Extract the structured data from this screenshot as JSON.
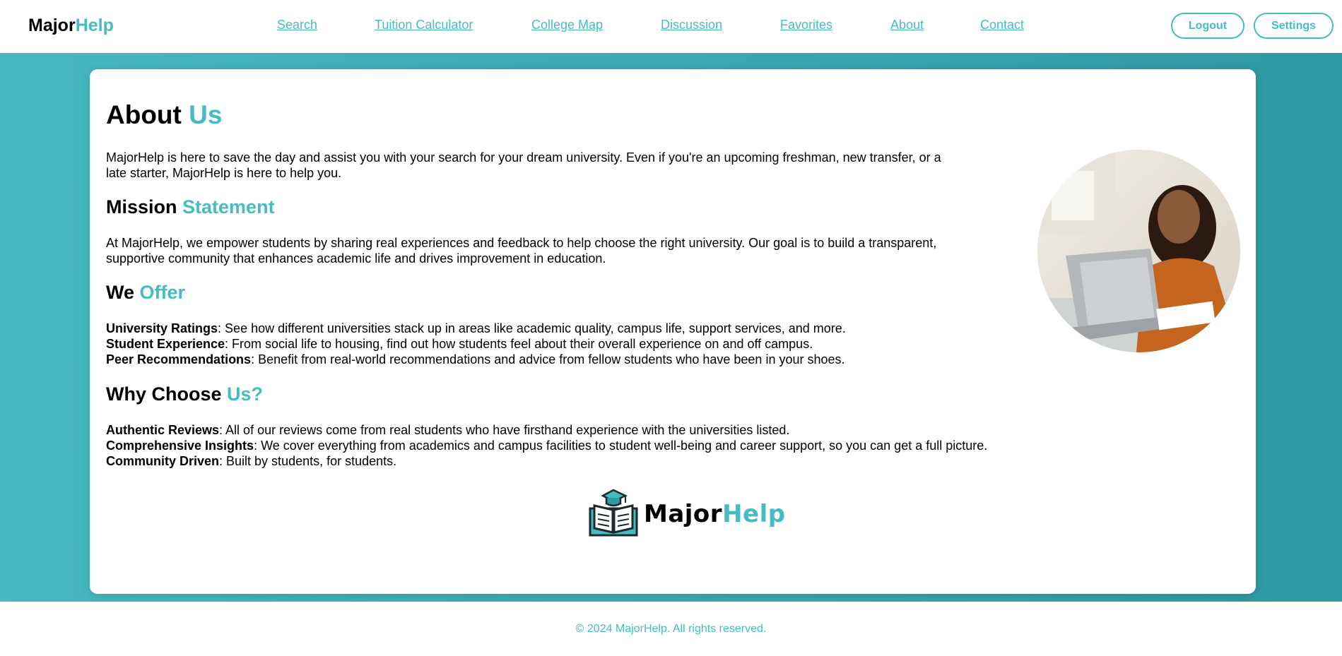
{
  "header": {
    "brand_main": "Major",
    "brand_accent": "Help",
    "nav": [
      "Search",
      "Tuition Calculator",
      "College Map",
      "Discussion",
      "Favorites",
      "About",
      "Contact"
    ],
    "logout_label": "Logout",
    "settings_label": "Settings"
  },
  "about": {
    "title_main": "About",
    "title_accent": "Us",
    "intro": "MajorHelp is here to save the day and assist you with your search for your dream university. Even if you're an upcoming freshman, new transfer, or a late starter, MajorHelp is here to help you.",
    "mission_main": "Mission",
    "mission_accent": "Statement",
    "mission_text": "At MajorHelp, we empower students by sharing real experiences and feedback to help choose the right university. Our goal is to build a transparent, supportive community that enhances academic life and drives improvement in education.",
    "offer_main": "We",
    "offer_accent": "Offer",
    "offers": [
      {
        "label": "University Ratings",
        "text": ": See how different universities stack up in areas like academic quality, campus life, support services, and more."
      },
      {
        "label": "Student Experience",
        "text": ": From social life to housing, find out how students feel about their overall experience on and off campus."
      },
      {
        "label": "Peer Recommendations",
        "text": ": Benefit from real-world recommendations and advice from fellow students who have been in your shoes."
      }
    ],
    "why_main": "Why Choose",
    "why_accent": "Us?",
    "why": [
      {
        "label": "Authentic Reviews",
        "text": ": All of our reviews come from real students who have firsthand experience with the universities listed."
      },
      {
        "label": "Comprehensive Insights",
        "text": ": We cover everything from academics and campus facilities to student well-being and career support, so you can get a full picture."
      },
      {
        "label": "Community Driven",
        "text": ": Built by students, for students."
      }
    ],
    "logo_main": "Major",
    "logo_accent": "Help"
  },
  "footer": {
    "copyright": "© 2024 MajorHelp. All rights reserved."
  },
  "colors": {
    "accent": "#45bcc4",
    "hero_bg": "#3aaab2"
  },
  "icons": {
    "logo": "book-graduation-cap-icon",
    "photo": "student-with-laptop-photo"
  }
}
